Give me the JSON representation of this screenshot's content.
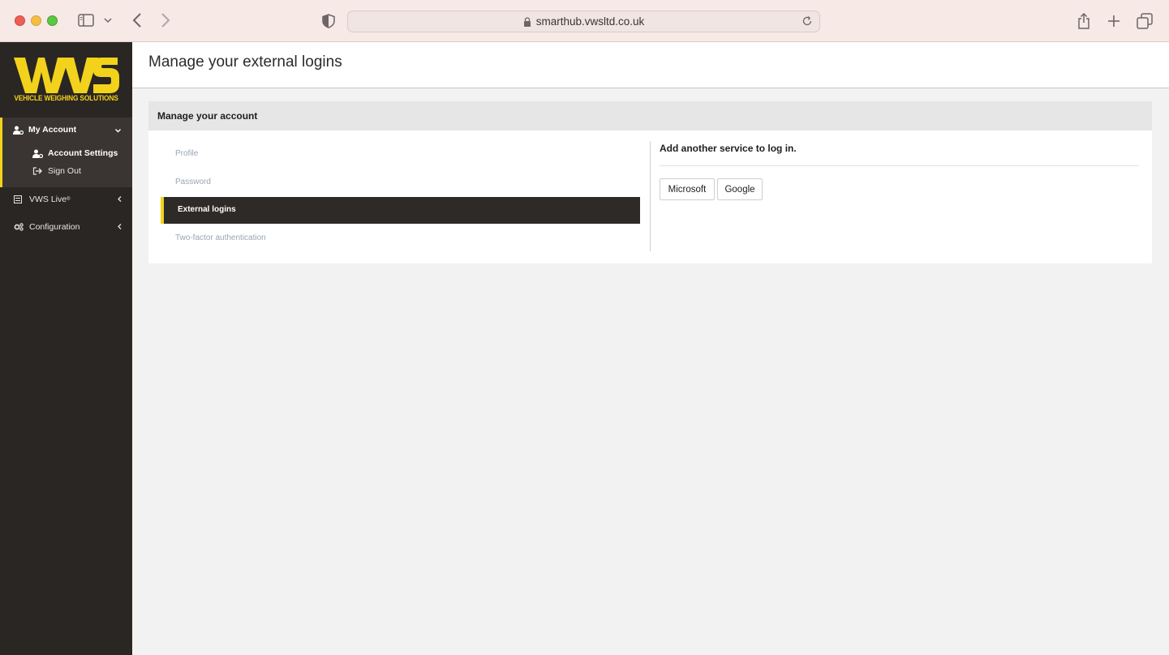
{
  "browser": {
    "url": "smarthub.vwsltd.co.uk"
  },
  "brand": {
    "logo_text": "VWS",
    "logo_subtitle": "VEHICLE WEIGHING SOLUTIONS",
    "accent_color": "#f3d21b"
  },
  "sidebar": {
    "my_account": "My Account",
    "account_settings": "Account Settings",
    "sign_out": "Sign Out",
    "vws_live": "VWS Live",
    "vws_live_mark": "®",
    "configuration": "Configuration"
  },
  "page": {
    "title": "Manage your external logins"
  },
  "panel": {
    "title": "Manage your account",
    "nav": {
      "profile": "Profile",
      "password": "Password",
      "external_logins": "External logins",
      "two_factor": "Two-factor authentication"
    },
    "right_title": "Add another service to log in.",
    "buttons": {
      "microsoft": "Microsoft",
      "google": "Google"
    }
  }
}
